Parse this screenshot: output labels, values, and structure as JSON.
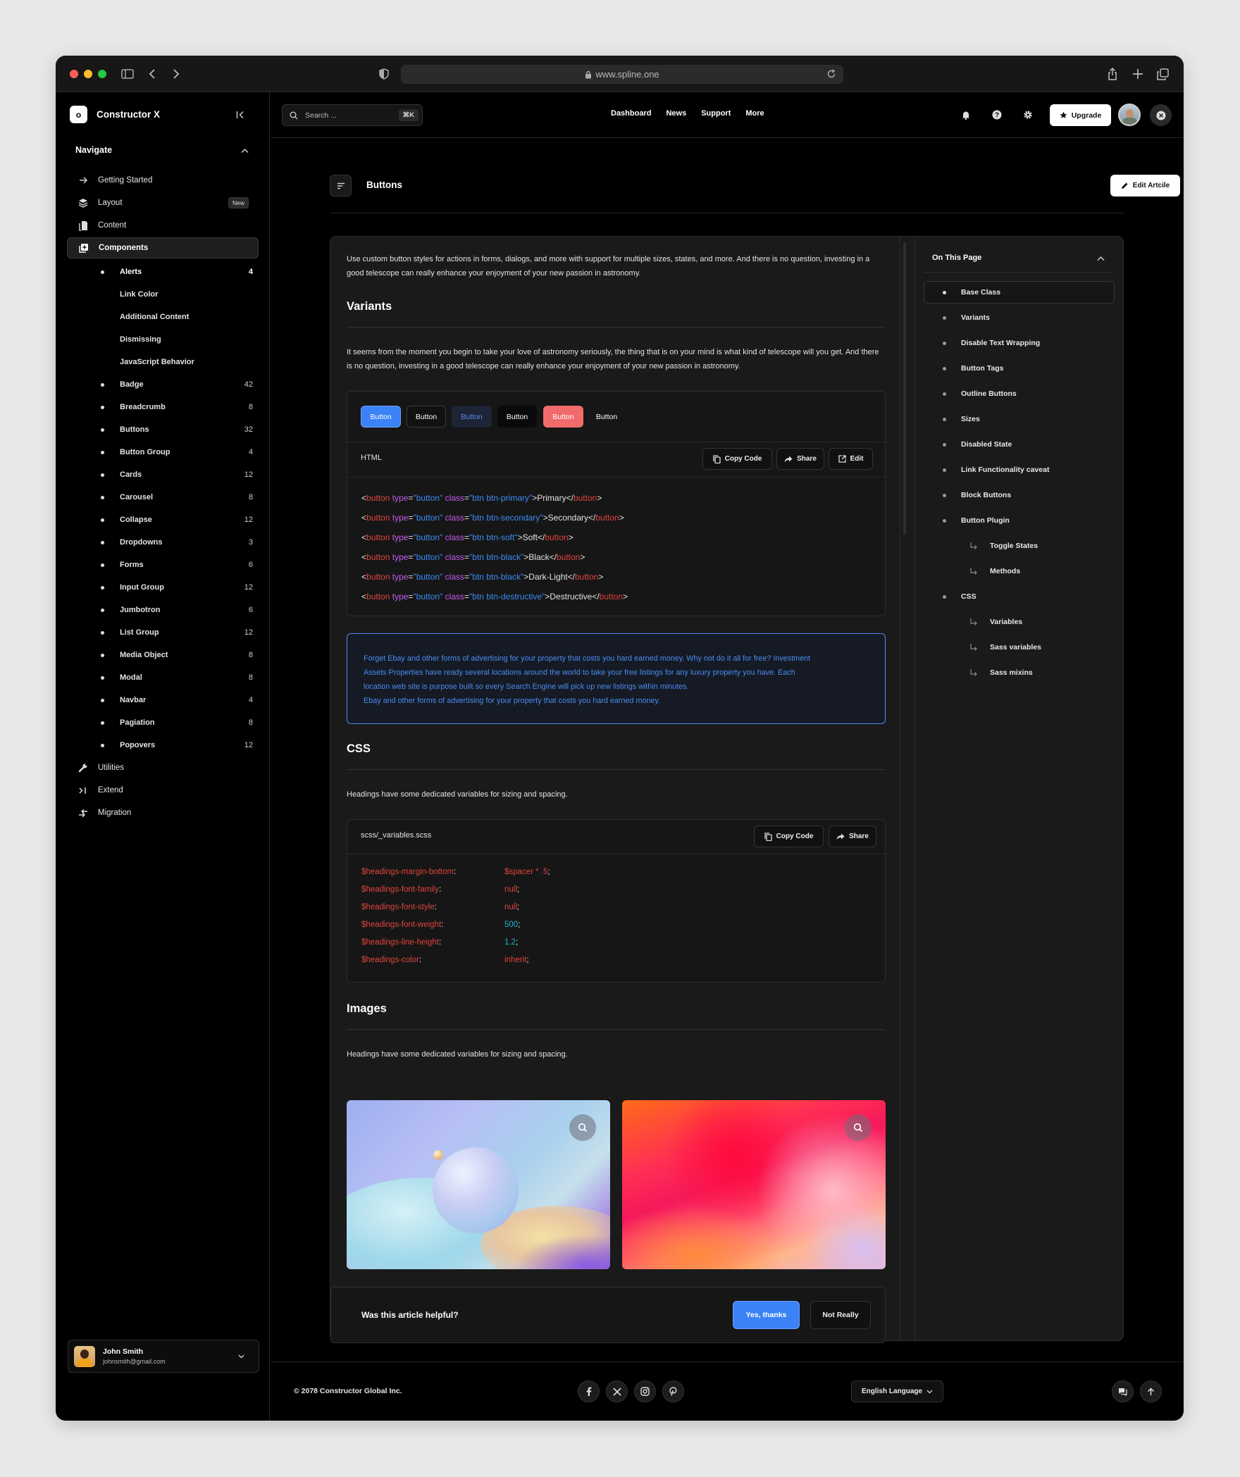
{
  "browser": {
    "url": "www.spline.one"
  },
  "sidebar": {
    "brand": "Constructor X",
    "brand_initial": "o",
    "nav_heading": "Navigate",
    "top_items": [
      {
        "label": "Getting Started",
        "icon": "arrow-right-icon"
      },
      {
        "label": "Layout",
        "icon": "layers-icon",
        "badge": "New"
      },
      {
        "label": "Content",
        "icon": "document-icon"
      },
      {
        "label": "Components",
        "icon": "plus-square-icon"
      }
    ],
    "components": [
      {
        "label": "Alerts",
        "count": "4"
      },
      {
        "label": "Link Color"
      },
      {
        "label": "Additional Content"
      },
      {
        "label": "Dismissing"
      },
      {
        "label": "JavaScript Behavior"
      },
      {
        "label": "Badge",
        "count": "42"
      },
      {
        "label": "Breadcrumb",
        "count": "8"
      },
      {
        "label": "Buttons",
        "count": "32"
      },
      {
        "label": "Button Group",
        "count": "4"
      },
      {
        "label": "Cards",
        "count": "12"
      },
      {
        "label": "Carousel",
        "count": "8"
      },
      {
        "label": "Collapse",
        "count": "12"
      },
      {
        "label": "Dropdowns",
        "count": "3"
      },
      {
        "label": "Forms",
        "count": "6"
      },
      {
        "label": "Input Group",
        "count": "12"
      },
      {
        "label": "Jumbotron",
        "count": "6"
      },
      {
        "label": "List Group",
        "count": "12"
      },
      {
        "label": "Media Object",
        "count": "8"
      },
      {
        "label": "Modal",
        "count": "8"
      },
      {
        "label": "Navbar",
        "count": "4"
      },
      {
        "label": "Pagiation",
        "count": "8"
      },
      {
        "label": "Popovers",
        "count": "12"
      }
    ],
    "bottom_items": [
      {
        "label": "Utilities",
        "icon": "wrench-icon"
      },
      {
        "label": "Extend",
        "icon": "terminal-icon"
      },
      {
        "label": "Migration",
        "icon": "migration-icon"
      }
    ],
    "user": {
      "name": "John Smith",
      "email": "johnsmith@gmail.com"
    }
  },
  "topbar": {
    "search_placeholder": "Search ...",
    "shortcut": "⌘K",
    "menu": [
      "Dashboard",
      "News",
      "Support",
      "More"
    ],
    "upgrade_label": "Upgrade"
  },
  "page": {
    "title": "Buttons",
    "edit_label": "Edit Artcile",
    "intro": "Use  custom button styles for actions in forms, dialogs, and more with support for multiple sizes, states, and more. And there is no question, investing in a good telescope can really enhance your enjoyment of your new passion in astronomy.",
    "variants_heading": "Variants",
    "variants_text": "It seems from the moment you begin to take your love of astronomy seriously, the thing that is on your mind is what kind of telescope will you get. And there is no question, investing in a good telescope can really enhance your enjoyment of your new passion in astronomy.",
    "preview_buttons": [
      "Button",
      "Button",
      "Button",
      "Button",
      "Button",
      "Button"
    ],
    "code_lang": "HTML",
    "copy_label": "Copy Code",
    "share_label": "Share",
    "edit_code_label": "Edit",
    "code_lines": [
      {
        "cls": "btn btn-primary",
        "text": "Primary"
      },
      {
        "cls": "btn btn-secondary",
        "text": "Secondary"
      },
      {
        "cls": "btn btn-soft",
        "text": "Soft"
      },
      {
        "cls": "btn btn-black",
        "text": "Black"
      },
      {
        "cls": "btn btn-black",
        "text": "Dark-Light"
      },
      {
        "cls": "btn btn-destructive",
        "text": "Destructive"
      }
    ],
    "code_tokens": {
      "open": "<",
      "tag": "button",
      "attr_type": "type",
      "eq": "=",
      "type_val": "\"button\"",
      "attr_class": "class",
      "close": ">",
      "end_open": "</",
      "end_close": ">"
    },
    "alert_lines": [
      "Forget Ebay and other forms of advertising for your property that costs you hard earned money. Why not do it all for free? Investment",
      "Assets Properties have ready several locations around the world to take your free listings for any luxury property you have. Each",
      "location web site is purpose built so every Search Engine will pick up new listings within minutes.",
      "Ebay and other forms of advertising for your property that costs you hard earned money."
    ],
    "css_heading": "CSS",
    "css_text": "Headings have some dedicated variables for sizing and spacing.",
    "css_file": "scss/_variables.scss",
    "scss_vars": [
      {
        "name": "$headings-margin-bottom",
        "value": "$spacer * .5"
      },
      {
        "name": "$headings-font-family",
        "value": "null"
      },
      {
        "name": "$headings-font-style",
        "value": "null"
      },
      {
        "name": "$headings-font-weight",
        "value": "500"
      },
      {
        "name": "$headings-line-height",
        "value": "1.2"
      },
      {
        "name": "$headings-color",
        "value": "inherit"
      }
    ],
    "images_heading": "Images",
    "images_text": "Headings have some dedicated variables for sizing and spacing.",
    "feedback_question": "Was this article helpful?",
    "feedback_yes": "Yes, thanks",
    "feedback_no": "Not Really"
  },
  "toc": {
    "heading": "On This Page",
    "items": [
      {
        "label": "Base Class",
        "level": 0
      },
      {
        "label": "Variants",
        "level": 0
      },
      {
        "label": "Disable Text Wrapping",
        "level": 0
      },
      {
        "label": "Button Tags",
        "level": 0
      },
      {
        "label": "Outline Buttons",
        "level": 0
      },
      {
        "label": "Sizes",
        "level": 0
      },
      {
        "label": "Disabled State",
        "level": 0
      },
      {
        "label": "Link Functionality caveat",
        "level": 0
      },
      {
        "label": "Block Buttons",
        "level": 0
      },
      {
        "label": "Button Plugin",
        "level": 0
      },
      {
        "label": "Toggle States",
        "level": 1
      },
      {
        "label": "Methods",
        "level": 1
      },
      {
        "label": "CSS",
        "level": 0
      },
      {
        "label": "Variables",
        "level": 1
      },
      {
        "label": "Sass variables",
        "level": 1
      },
      {
        "label": "Sass mixins",
        "level": 1
      }
    ]
  },
  "footer": {
    "copyright": "© 2078 Constructor Global Inc.",
    "language": "English Language",
    "social": [
      "facebook-icon",
      "x-icon",
      "instagram-icon",
      "pinterest-icon"
    ]
  },
  "colors": {
    "primary": "#3b82f6",
    "destructive": "#f26b6b",
    "code_tag": "#e0443f",
    "code_attr": "#c65bf0",
    "code_value": "#3b8bf5",
    "alert_text": "#4a8cf0"
  }
}
